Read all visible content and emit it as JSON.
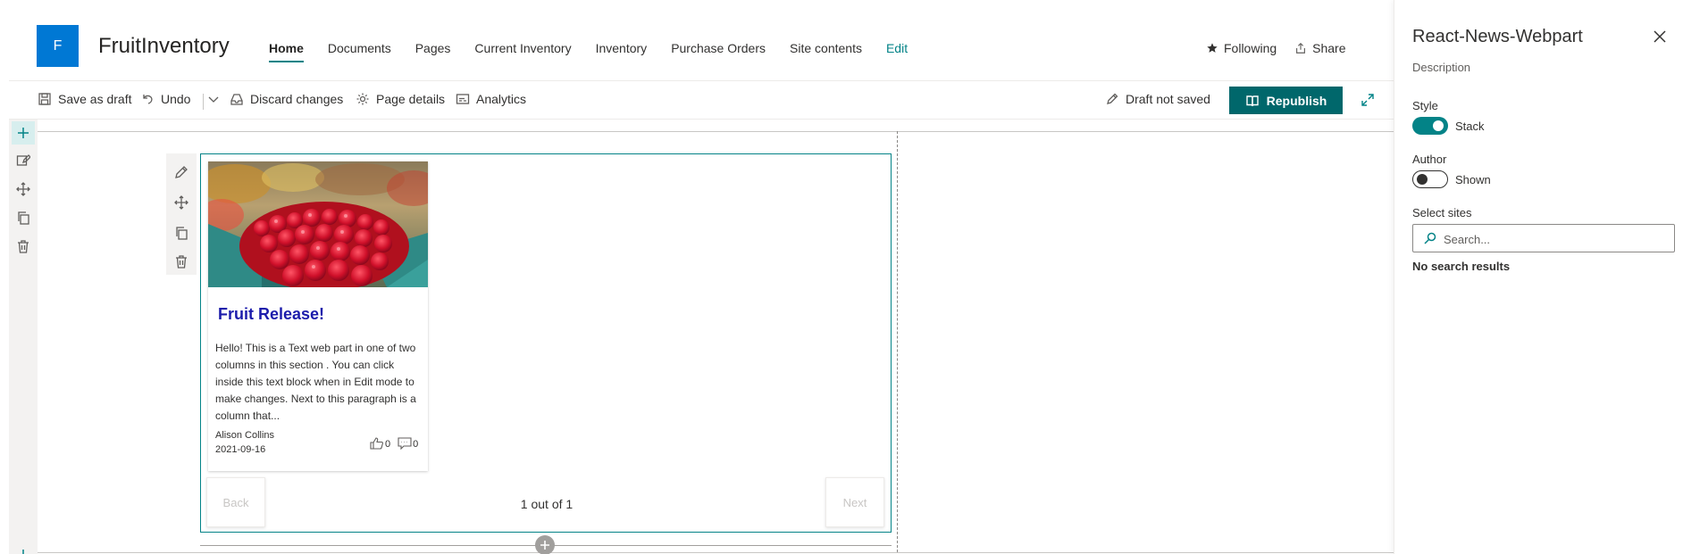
{
  "site": {
    "logo_letter": "F",
    "title": "FruitInventory",
    "brand_color": "#0078d4",
    "accent_color": "#038387"
  },
  "nav": {
    "items": [
      {
        "label": "Home",
        "active": true
      },
      {
        "label": "Documents"
      },
      {
        "label": "Pages"
      },
      {
        "label": "Current Inventory"
      },
      {
        "label": "Inventory"
      },
      {
        "label": "Purchase Orders"
      },
      {
        "label": "Site contents"
      },
      {
        "label": "Edit"
      }
    ],
    "following_label": "Following",
    "share_label": "Share"
  },
  "command_bar": {
    "save_draft_label": "Save as draft",
    "undo_label": "Undo",
    "discard_label": "Discard changes",
    "page_details_label": "Page details",
    "analytics_label": "Analytics",
    "status_label": "Draft not saved",
    "republish_label": "Republish"
  },
  "news_card": {
    "title": "Fruit Release!",
    "body": "Hello! This is a Text web part in one of two columns in this section . You can click inside this text block when in Edit mode to make changes. Next to this paragraph is a column that...",
    "author": "Alison Collins",
    "date": "2021-09-16",
    "likes": "0",
    "comments": "0",
    "title_color": "#1c1cab"
  },
  "pager": {
    "back_label": "Back",
    "next_label": "Next",
    "count_label": "1 out of 1"
  },
  "property_pane": {
    "title": "React-News-Webpart",
    "description": "Description",
    "style_label": "Style",
    "style_value": "Stack",
    "style_on": true,
    "author_label": "Author",
    "author_value": "Shown",
    "author_on": false,
    "sites_label": "Select sites",
    "search_placeholder": "Search...",
    "no_results": "No search results"
  }
}
